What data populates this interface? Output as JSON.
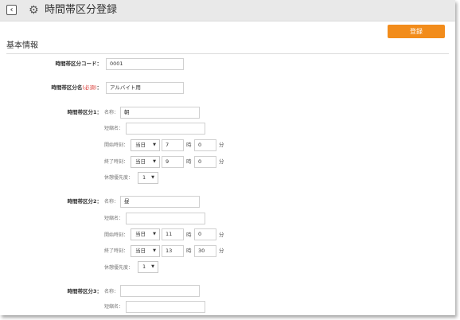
{
  "header": {
    "back_icon": "chevron-left-icon",
    "gear_icon": "gear-icon",
    "title": "時間帯区分登録"
  },
  "toolbar": {
    "register_label": "登録",
    "accent": "#f28c1b"
  },
  "section": {
    "title": "基本情報"
  },
  "code_field": {
    "label": "時間帯区分コード：",
    "value": "0001"
  },
  "name_field": {
    "label": "時間帯区分名",
    "required": "(必須)",
    "suffix": "：",
    "value": "アルバイト用"
  },
  "sublabels": {
    "name": "名称：",
    "short": "短縮名：",
    "start": "開始時刻：",
    "end": "終了時刻：",
    "priority": "休憩優先度："
  },
  "units": {
    "hour": "時",
    "minute": "分"
  },
  "slot1": {
    "label": "時間帯区分1：",
    "name": "朝",
    "short": "",
    "start_day": "当日",
    "start_hour": "7",
    "start_min": "0",
    "end_day": "当日",
    "end_hour": "9",
    "end_min": "0",
    "priority": "1"
  },
  "slot2": {
    "label": "時間帯区分2：",
    "name": "昼",
    "short": "",
    "start_day": "当日",
    "start_hour": "11",
    "start_min": "0",
    "end_day": "当日",
    "end_hour": "13",
    "end_min": "30",
    "priority": "1"
  },
  "slot3": {
    "label": "時間帯区分3：",
    "name": "",
    "short": ""
  }
}
